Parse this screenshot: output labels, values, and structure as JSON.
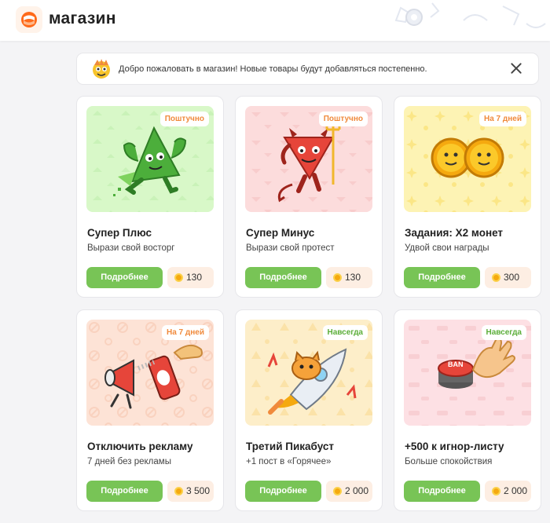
{
  "app": {
    "title": "магазин"
  },
  "banner": {
    "text": "Добро пожаловать в магазин! Новые товары будут добавляться постепенно."
  },
  "colors": {
    "accent_green": "#78c456",
    "badge_orange": "#f08a3c",
    "badge_green": "#5cae3a",
    "price_bg": "#fdeee3"
  },
  "cards": [
    {
      "title": "Супер Плюс",
      "subtitle": "Вырази свой восторг",
      "badge": "Поштучно",
      "badge_color": "#f08a3c",
      "button": "Подробнее",
      "price": "130",
      "image": "green-plus-arrow-mascot"
    },
    {
      "title": "Супер Минус",
      "subtitle": "Вырази свой протест",
      "badge": "Поштучно",
      "badge_color": "#f08a3c",
      "button": "Подробнее",
      "price": "130",
      "image": "red-minus-devil-mascot"
    },
    {
      "title": "Задания: Х2 монет",
      "subtitle": "Удвой свои награды",
      "badge": "На 7 дней",
      "badge_color": "#f08a3c",
      "button": "Подробнее",
      "price": "300",
      "image": "two-coins-mascot"
    },
    {
      "title": "Отключить рекламу",
      "subtitle": "7 дней без рекламы",
      "badge": "На 7 дней",
      "badge_color": "#f08a3c",
      "button": "Подробнее",
      "price": "3 500",
      "image": "spray-on-megaphone"
    },
    {
      "title": "Третий Пикабуст",
      "subtitle": "+1 пост в «Горячее»",
      "badge": "Навсегда",
      "badge_color": "#5cae3a",
      "button": "Подробнее",
      "price": "2 000",
      "image": "cat-on-rocket"
    },
    {
      "title": "+500 к игнор-листу",
      "subtitle": "Больше спокойствия",
      "badge": "Навсегда",
      "badge_color": "#5cae3a",
      "button": "Подробнее",
      "price": "2 000",
      "image": "hand-ban-button"
    }
  ]
}
